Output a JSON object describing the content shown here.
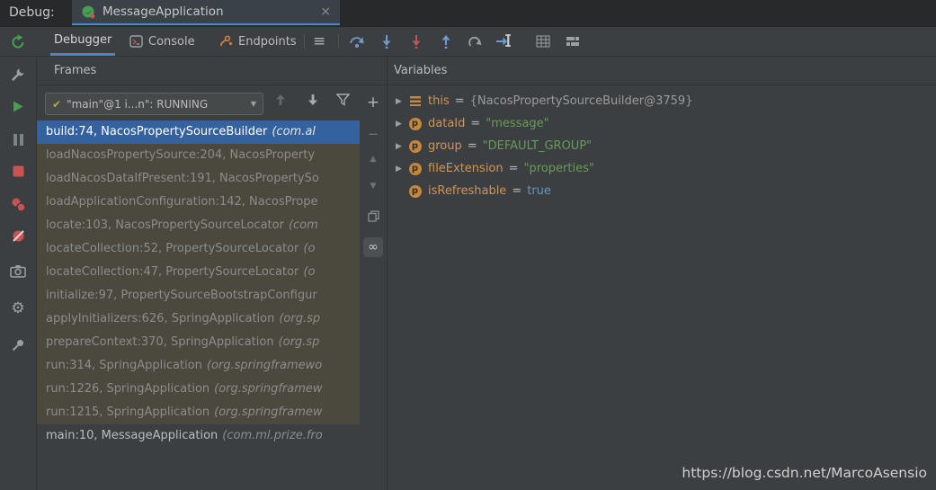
{
  "topbar": {
    "debug_label": "Debug:",
    "tab_title": "MessageApplication"
  },
  "toolbar": {
    "tabs": [
      "Debugger",
      "Console",
      "Endpoints"
    ]
  },
  "icons": {
    "close": "×",
    "menu": "≡",
    "check": "✔",
    "dropdown_arrow": "▼",
    "chevron": "▶",
    "plus": "+",
    "minus": "−",
    "move_up": "▲",
    "move_down": "▼",
    "infinity": "∞",
    "gear": "⚙",
    "param": "p"
  },
  "frames": {
    "title": "Frames",
    "thread_selector": "\"main\"@1 i...n\": RUNNING",
    "rows": [
      {
        "label": "build:74, NacosPropertySourceBuilder",
        "pkg": "(com.al",
        "state": "selected"
      },
      {
        "label": "loadNacosPropertySource:204, NacosProperty",
        "pkg": "",
        "state": "library"
      },
      {
        "label": "loadNacosDataIfPresent:191, NacosPropertySo",
        "pkg": "",
        "state": "library"
      },
      {
        "label": "loadApplicationConfiguration:142, NacosPrope",
        "pkg": "",
        "state": "library"
      },
      {
        "label": "locate:103, NacosPropertySourceLocator",
        "pkg": "(com",
        "state": "library"
      },
      {
        "label": "locateCollection:52, PropertySourceLocator",
        "pkg": "(o",
        "state": "library"
      },
      {
        "label": "locateCollection:47, PropertySourceLocator",
        "pkg": "(o",
        "state": "library"
      },
      {
        "label": "initialize:97, PropertySourceBootstrapConfigur",
        "pkg": "",
        "state": "library"
      },
      {
        "label": "applyInitializers:626, SpringApplication",
        "pkg": "(org.sp",
        "state": "library"
      },
      {
        "label": "prepareContext:370, SpringApplication",
        "pkg": "(org.sp",
        "state": "library"
      },
      {
        "label": "run:314, SpringApplication",
        "pkg": "(org.springframewo",
        "state": "library"
      },
      {
        "label": "run:1226, SpringApplication",
        "pkg": "(org.springframew",
        "state": "library"
      },
      {
        "label": "run:1215, SpringApplication",
        "pkg": "(org.springframew",
        "state": "library"
      },
      {
        "label": "main:10, MessageApplication",
        "pkg": "(com.ml.prize.fro",
        "state": "normal"
      }
    ]
  },
  "variables": {
    "title": "Variables",
    "rows": [
      {
        "name": "this",
        "eq": "=",
        "value": "{NacosPropertySourceBuilder@3759}",
        "kind": "object"
      },
      {
        "name": "dataId",
        "eq": "=",
        "value": "\"message\"",
        "kind": "string"
      },
      {
        "name": "group",
        "eq": "=",
        "value": "\"DEFAULT_GROUP\"",
        "kind": "string"
      },
      {
        "name": "fileExtension",
        "eq": "=",
        "value": "\"properties\"",
        "kind": "string"
      },
      {
        "name": "isRefreshable",
        "eq": "=",
        "value": "true",
        "kind": "boolean"
      }
    ]
  },
  "colors": {
    "selection_blue": "#33629f",
    "library_row_bg": "#4b483d",
    "tab_accent_blue": "#4a88c7",
    "string_green": "#6a9a5b",
    "boolean_blue": "#6897bb",
    "variable_name_amber": "#cf9456",
    "stop_red": "#c75450",
    "run_green": "#499c54"
  },
  "watermark": "https://blog.csdn.net/MarcoAsensio"
}
